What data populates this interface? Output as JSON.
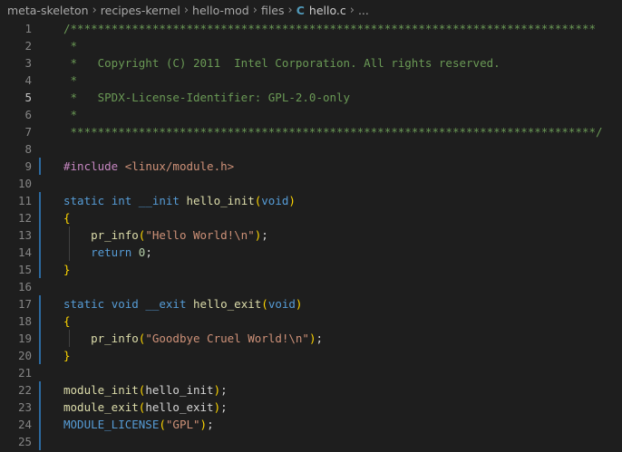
{
  "breadcrumb": {
    "items": [
      "meta-skeleton",
      "recipes-kernel",
      "hello-mod",
      "files"
    ],
    "file_icon": "C",
    "file_name": "hello.c",
    "trailing": "..."
  },
  "colors": {
    "comment": "#6a9955",
    "keyword": "#569cd6",
    "function": "#dcdcaa",
    "string": "#ce9178",
    "number": "#b5cea8",
    "preprocessor": "#c586c0",
    "brace": "#ffd700",
    "modified_gutter": "#2c6aa0"
  },
  "editor": {
    "active_line": 5,
    "lines": [
      {
        "n": "1",
        "tokens": [
          {
            "t": "c",
            "v": "/*****************************************************************************"
          }
        ]
      },
      {
        "n": "2",
        "tokens": [
          {
            "t": "c",
            "v": " *"
          }
        ]
      },
      {
        "n": "3",
        "tokens": [
          {
            "t": "c",
            "v": " *   Copyright (C) 2011  Intel Corporation. All rights reserved."
          }
        ]
      },
      {
        "n": "4",
        "tokens": [
          {
            "t": "c",
            "v": " *"
          }
        ]
      },
      {
        "n": "5",
        "tokens": [
          {
            "t": "c",
            "v": " *   SPDX-License-Identifier: GPL-2.0-only"
          }
        ]
      },
      {
        "n": "6",
        "tokens": [
          {
            "t": "c",
            "v": " *"
          }
        ]
      },
      {
        "n": "7",
        "tokens": [
          {
            "t": "c",
            "v": " *****************************************************************************/"
          }
        ]
      },
      {
        "n": "8",
        "tokens": []
      },
      {
        "n": "9",
        "mod": true,
        "tokens": [
          {
            "t": "pp",
            "v": "#include"
          },
          {
            "t": "p",
            "v": " "
          },
          {
            "t": "s",
            "v": "<linux/module.h>"
          }
        ]
      },
      {
        "n": "10",
        "tokens": []
      },
      {
        "n": "11",
        "mod": true,
        "tokens": [
          {
            "t": "k",
            "v": "static"
          },
          {
            "t": "p",
            "v": " "
          },
          {
            "t": "k",
            "v": "int"
          },
          {
            "t": "p",
            "v": " "
          },
          {
            "t": "k",
            "v": "__init"
          },
          {
            "t": "p",
            "v": " "
          },
          {
            "t": "f",
            "v": "hello_init"
          },
          {
            "t": "b",
            "v": "("
          },
          {
            "t": "k",
            "v": "void"
          },
          {
            "t": "b",
            "v": ")"
          }
        ]
      },
      {
        "n": "12",
        "mod": true,
        "tokens": [
          {
            "t": "b",
            "v": "{"
          }
        ]
      },
      {
        "n": "13",
        "mod": true,
        "guide": true,
        "tokens": [
          {
            "t": "p",
            "v": "    "
          },
          {
            "t": "f",
            "v": "pr_info"
          },
          {
            "t": "b",
            "v": "("
          },
          {
            "t": "s",
            "v": "\"Hello World!\\n\""
          },
          {
            "t": "b",
            "v": ")"
          },
          {
            "t": "p",
            "v": ";"
          }
        ]
      },
      {
        "n": "14",
        "mod": true,
        "guide": true,
        "tokens": [
          {
            "t": "p",
            "v": "    "
          },
          {
            "t": "k",
            "v": "return"
          },
          {
            "t": "p",
            "v": " "
          },
          {
            "t": "num",
            "v": "0"
          },
          {
            "t": "p",
            "v": ";"
          }
        ]
      },
      {
        "n": "15",
        "mod": true,
        "tokens": [
          {
            "t": "b",
            "v": "}"
          }
        ]
      },
      {
        "n": "16",
        "tokens": []
      },
      {
        "n": "17",
        "mod": true,
        "tokens": [
          {
            "t": "k",
            "v": "static"
          },
          {
            "t": "p",
            "v": " "
          },
          {
            "t": "k",
            "v": "void"
          },
          {
            "t": "p",
            "v": " "
          },
          {
            "t": "k",
            "v": "__exit"
          },
          {
            "t": "p",
            "v": " "
          },
          {
            "t": "f",
            "v": "hello_exit"
          },
          {
            "t": "b",
            "v": "("
          },
          {
            "t": "k",
            "v": "void"
          },
          {
            "t": "b",
            "v": ")"
          }
        ]
      },
      {
        "n": "18",
        "mod": true,
        "tokens": [
          {
            "t": "b",
            "v": "{"
          }
        ]
      },
      {
        "n": "19",
        "mod": true,
        "guide": true,
        "tokens": [
          {
            "t": "p",
            "v": "    "
          },
          {
            "t": "f",
            "v": "pr_info"
          },
          {
            "t": "b",
            "v": "("
          },
          {
            "t": "s",
            "v": "\"Goodbye Cruel World!\\n\""
          },
          {
            "t": "b",
            "v": ")"
          },
          {
            "t": "p",
            "v": ";"
          }
        ]
      },
      {
        "n": "20",
        "mod": true,
        "tokens": [
          {
            "t": "b",
            "v": "}"
          }
        ]
      },
      {
        "n": "21",
        "tokens": []
      },
      {
        "n": "22",
        "mod": true,
        "tokens": [
          {
            "t": "f",
            "v": "module_init"
          },
          {
            "t": "b",
            "v": "("
          },
          {
            "t": "p",
            "v": "hello_init"
          },
          {
            "t": "b",
            "v": ")"
          },
          {
            "t": "p",
            "v": ";"
          }
        ]
      },
      {
        "n": "23",
        "mod": true,
        "tokens": [
          {
            "t": "f",
            "v": "module_exit"
          },
          {
            "t": "b",
            "v": "("
          },
          {
            "t": "p",
            "v": "hello_exit"
          },
          {
            "t": "b",
            "v": ")"
          },
          {
            "t": "p",
            "v": ";"
          }
        ]
      },
      {
        "n": "24",
        "mod": true,
        "tokens": [
          {
            "t": "m",
            "v": "MODULE_LICENSE"
          },
          {
            "t": "b",
            "v": "("
          },
          {
            "t": "s",
            "v": "\"GPL\""
          },
          {
            "t": "b",
            "v": ")"
          },
          {
            "t": "p",
            "v": ";"
          }
        ]
      },
      {
        "n": "25",
        "mod": true,
        "tokens": []
      }
    ]
  }
}
